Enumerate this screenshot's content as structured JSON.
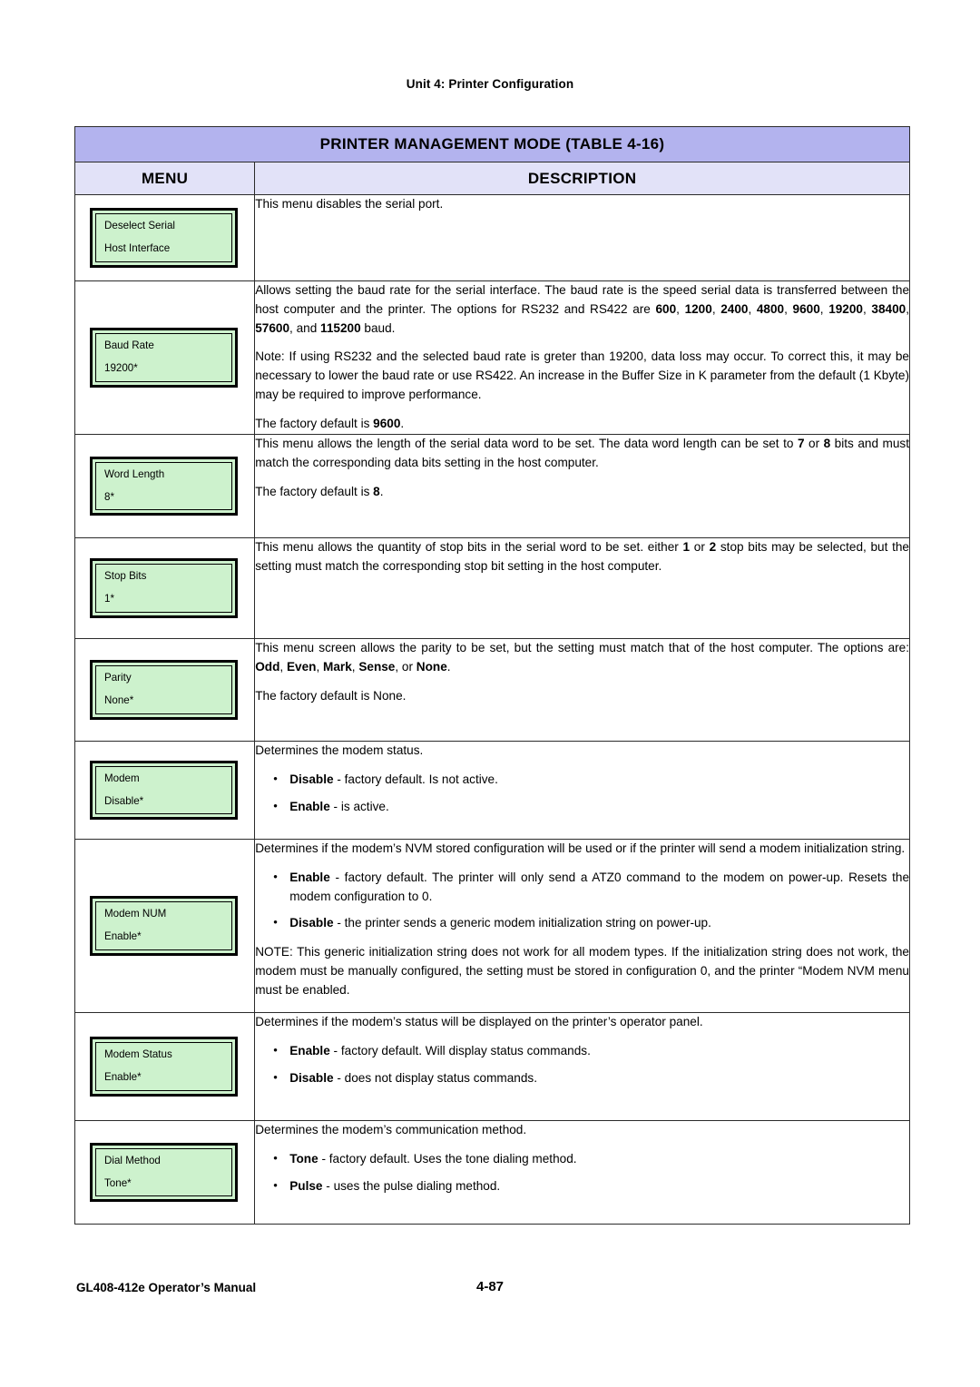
{
  "page": {
    "running_head": "Unit 4:  Printer Configuration",
    "footer_left": "GL408-412e Operator’s Manual",
    "footer_page": "4-87",
    "colors": {
      "title_bar": "#b3b3ee",
      "header_row": "#e2e2f8",
      "lcd_screen": "#cdf2cd",
      "border": "#2b2b2b"
    }
  },
  "table": {
    "title": "PRINTER MANAGEMENT MODE (TABLE 4-16)",
    "headers": {
      "menu": "MENU",
      "description": "DESCRIPTION"
    },
    "rows": [
      {
        "menu": {
          "line1": "Deselect Serial",
          "line2": "Host Interface"
        },
        "paragraphs": [
          "This menu disables the serial port."
        ]
      },
      {
        "menu": {
          "line1": "Baud Rate",
          "line2": "19200*"
        },
        "p1_a": "Allows setting the baud rate for the serial interface. The baud rate is the speed serial data is transferred between the host computer and the printer. The options for RS232 and RS422 are ",
        "p1_b": "600",
        "p1_c": ", ",
        "p1_d": "1200",
        "p1_e": ", ",
        "p1_f": "2400",
        "p1_g": ", ",
        "p1_h": "4800",
        "p1_i": ", ",
        "p1_j": "9600",
        "p1_k": ", ",
        "p1_l": "19200",
        "p1_m": ", ",
        "p1_n": "38400",
        "p1_o": ", ",
        "p1_p": "57600",
        "p1_q": ", and ",
        "p1_r": "115200",
        "p1_s": " baud.",
        "p2": "Note: If using RS232 and the selected baud rate is greter than 19200, data loss may occur. To correct this, it may be necessary to lower the baud rate or use RS422. An increase in the Buffer Size in K parameter from the default (1 Kbyte) may be required to improve performance.",
        "p3_a": "The factory default is ",
        "p3_b": "9600",
        "p3_c": "."
      },
      {
        "menu": {
          "line1": "Word Length",
          "line2": "8*"
        },
        "p1_a": "This menu allows the length of the serial data word to be set. The data word length can be set to ",
        "p1_b": "7",
        "p1_c": " or ",
        "p1_d": "8",
        "p1_e": " bits and must match the corresponding data bits setting in the host computer.",
        "p2_a": "The factory default is ",
        "p2_b": "8",
        "p2_c": "."
      },
      {
        "menu": {
          "line1": "Stop Bits",
          "line2": "1*"
        },
        "p1_a": "This menu allows the quantity of stop bits in the serial word to be set. either ",
        "p1_b": "1",
        "p1_c": " or ",
        "p1_d": "2",
        "p1_e": " stop bits may be selected, but the setting must match the corresponding stop bit setting in the host computer."
      },
      {
        "menu": {
          "line1": "Parity",
          "line2": "None*"
        },
        "p1_a": "This menu screen allows the parity to be set, but the setting must match that of the host computer. The options are: ",
        "p1_b": "Odd",
        "p1_c": ", ",
        "p1_d": "Even",
        "p1_e": ", ",
        "p1_f": "Mark",
        "p1_g": ", ",
        "p1_h": "Sense",
        "p1_i": ", or ",
        "p1_j": "None",
        "p1_k": ".",
        "p2": "The factory default is None."
      },
      {
        "menu": {
          "line1": "Modem",
          "line2": "Disable*"
        },
        "p1": "Determines the modem status.",
        "b1_label": "Disable",
        "b1_text": " - factory default. Is not active.",
        "b2_label": "Enable",
        "b2_text": " - is active."
      },
      {
        "menu": {
          "line1": "Modem NUM",
          "line2": "Enable*"
        },
        "p1": "Determines if the modem’s NVM stored configuration will be used or if the printer will send a modem initialization string.",
        "b1_label": "Enable",
        "b1_text": " - factory default. The printer will only send a ATZ0 command to the modem on power-up. Resets the modem configuration to 0.",
        "b2_label": "Disable",
        "b2_text": " - the printer sends a generic modem initialization string on power-up.",
        "p2": "NOTE: This generic initialization string does not work for all modem types. If the initialization string does not work, the modem must be manually configured, the setting must be stored in configuration 0, and the printer “Modem NVM menu must be enabled."
      },
      {
        "menu": {
          "line1": "Modem Status",
          "line2": "Enable*"
        },
        "p1": "Determines if the modem’s status will be displayed on the printer’s operator panel.",
        "b1_label": "Enable",
        "b1_text": " - factory default. Will display status commands.",
        "b2_label": "Disable",
        "b2_text": " - does not display status commands."
      },
      {
        "menu": {
          "line1": "Dial Method",
          "line2": "Tone*"
        },
        "p1": "Determines the modem’s communication method.",
        "b1_label": "Tone",
        "b1_text": " - factory default. Uses the tone dialing method.",
        "b2_label": "Pulse",
        "b2_text": " - uses the pulse dialing method."
      }
    ]
  }
}
